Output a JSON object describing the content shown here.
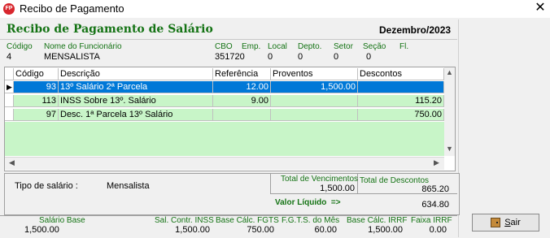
{
  "window": {
    "title": "Recibo de Pagamento",
    "icon_text": "FP",
    "close_glyph": "✕"
  },
  "header": {
    "title": "Recibo de Pagamento de Salário",
    "period": "Dezembro/2023"
  },
  "employee": {
    "code_label": "Código",
    "code": "4",
    "name_label": "Nome do Funcionário",
    "name": "MENSALISTA",
    "cbo_label": "CBO",
    "cbo": "351720",
    "emp_label": "Emp.",
    "local_label": "Local",
    "local": "0",
    "depto_label": "Depto.",
    "depto": "0",
    "setor_label": "Setor",
    "setor": "0",
    "secao_label": "Seção",
    "secao": "0",
    "fl_label": "Fl."
  },
  "grid": {
    "columns": [
      "Código",
      "Descrição",
      "Referência",
      "Proventos",
      "Descontos"
    ],
    "rows": [
      {
        "code": "93",
        "desc": "13º Salário 2ª Parcela",
        "ref": "12.00",
        "prov": "1,500.00",
        "desc_val": ""
      },
      {
        "code": "113",
        "desc": "INSS Sobre 13º. Salário",
        "ref": "9.00",
        "prov": "",
        "desc_val": "115.20"
      },
      {
        "code": "97",
        "desc": "Desc. 1ª Parcela 13º Salário",
        "ref": "",
        "prov": "",
        "desc_val": "750.00"
      }
    ]
  },
  "summary": {
    "tipo_label": "Tipo de salário :",
    "tipo_value": "Mensalista",
    "total_venc_label": "Total de Vencimentos",
    "total_venc": "1,500.00",
    "total_desc_label": "Total de Descontos",
    "total_desc": "865.20",
    "liquido_label": "Valor Líquido  =>",
    "liquido": "634.80"
  },
  "footer": {
    "salario_base_label": "Salário Base",
    "salario_base": "1,500.00",
    "sal_contr_label": "Sal. Contr. INSS",
    "sal_contr": "1,500.00",
    "base_fgts_label": "Base Cálc. FGTS",
    "base_fgts": "750.00",
    "fgts_mes_label": "F.G.T.S. do Mês",
    "fgts_mes": "60.00",
    "base_irrf_label": "Base Cálc. IRRF",
    "base_irrf": "1,500.00",
    "faixa_irrf_label": "Faixa IRRF",
    "faixa_irrf": "0.00"
  },
  "buttons": {
    "exit_accel": "S",
    "exit_rest": "air"
  },
  "colors": {
    "label_green": "#147314",
    "row_green": "#c8f5c8",
    "selection": "#0078d7"
  }
}
